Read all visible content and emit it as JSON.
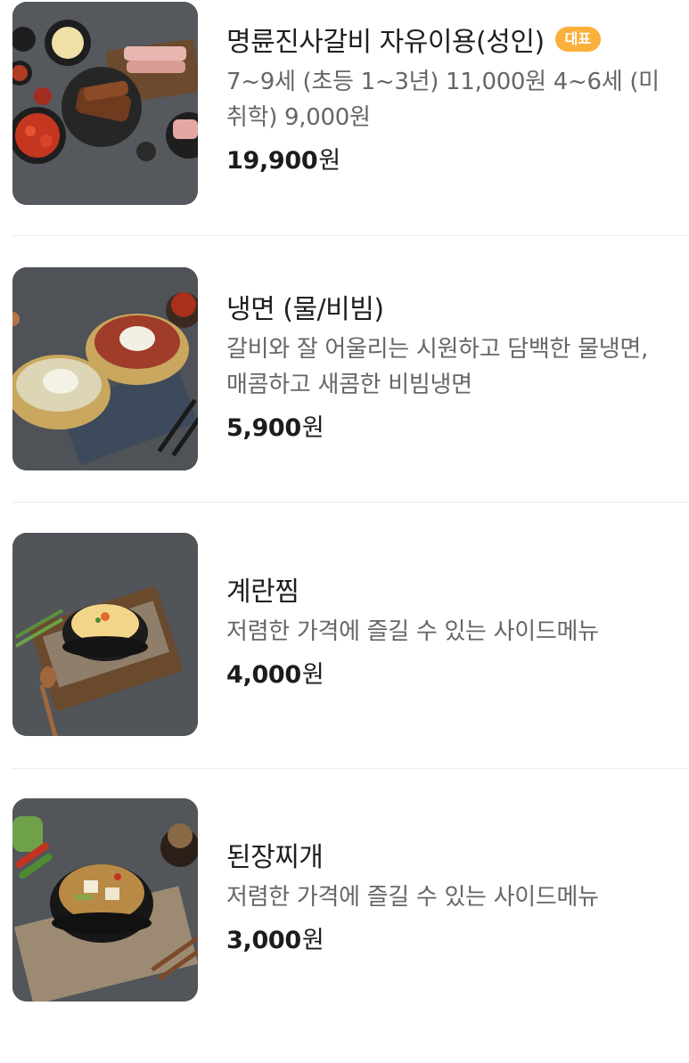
{
  "menu": {
    "items": [
      {
        "name": "명륜진사갈비 자유이용(성인)",
        "badge": "대표",
        "description": "7~9세 (초등 1~3년) 11,000원 4~6세 (미취학) 9,000원",
        "price": "19,900",
        "currency": "원",
        "image_icon": "galbi-platter-photo"
      },
      {
        "name": "냉면 (물/비빔)",
        "badge": "",
        "description": "갈비와 잘 어울리는 시원하고 담백한 물냉면, 매콤하고 새콤한 비빔냉면",
        "price": "5,900",
        "currency": "원",
        "image_icon": "naengmyeon-photo"
      },
      {
        "name": "계란찜",
        "badge": "",
        "description": "저렴한 가격에 즐길 수 있는 사이드메뉴",
        "price": "4,000",
        "currency": "원",
        "image_icon": "steamed-egg-photo"
      },
      {
        "name": "된장찌개",
        "badge": "",
        "description": "저렴한 가격에 즐길 수 있는 사이드메뉴",
        "price": "3,000",
        "currency": "원",
        "image_icon": "doenjang-stew-photo"
      }
    ]
  },
  "colors": {
    "badge": "#fbb03b",
    "description": "#666666",
    "divider": "#ececec"
  }
}
